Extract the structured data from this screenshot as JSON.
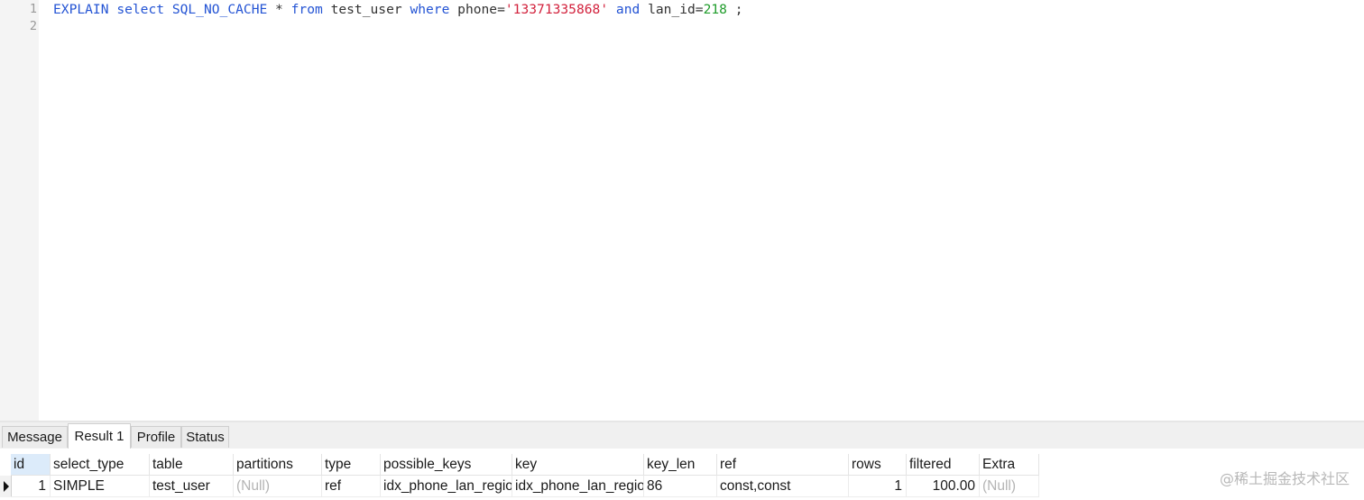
{
  "editor": {
    "line_numbers": [
      "1",
      "2"
    ],
    "query_tokens": [
      {
        "text": "EXPLAIN",
        "color": "#2454d4"
      },
      {
        "text": " ",
        "color": "#333333"
      },
      {
        "text": "select",
        "color": "#2454d4"
      },
      {
        "text": " ",
        "color": "#333333"
      },
      {
        "text": "SQL_NO_CACHE",
        "color": "#2454d4"
      },
      {
        "text": " * ",
        "color": "#333333"
      },
      {
        "text": "from",
        "color": "#2454d4"
      },
      {
        "text": " test_user ",
        "color": "#333333"
      },
      {
        "text": "where",
        "color": "#2454d4"
      },
      {
        "text": " phone=",
        "color": "#333333"
      },
      {
        "text": "'13371335868'",
        "color": "#d2213c"
      },
      {
        "text": " ",
        "color": "#333333"
      },
      {
        "text": "and",
        "color": "#2454d4"
      },
      {
        "text": " lan_id=",
        "color": "#333333"
      },
      {
        "text": "218",
        "color": "#1f9c2a"
      },
      {
        "text": " ;",
        "color": "#333333"
      }
    ]
  },
  "tabs": [
    {
      "label": "Message",
      "active": false
    },
    {
      "label": "Result 1",
      "active": true
    },
    {
      "label": "Profile",
      "active": false
    },
    {
      "label": "Status",
      "active": false
    }
  ],
  "grid": {
    "columns": [
      "id",
      "select_type",
      "table",
      "partitions",
      "type",
      "possible_keys",
      "key",
      "key_len",
      "ref",
      "rows",
      "filtered",
      "Extra"
    ],
    "rows": [
      [
        "1",
        "SIMPLE",
        "test_user",
        "(Null)",
        "ref",
        "idx_phone_lan_region",
        "idx_phone_lan_region",
        "86",
        "const,const",
        "1",
        "100.00",
        "(Null)"
      ]
    ]
  },
  "watermark": "@稀土掘金技术社区"
}
